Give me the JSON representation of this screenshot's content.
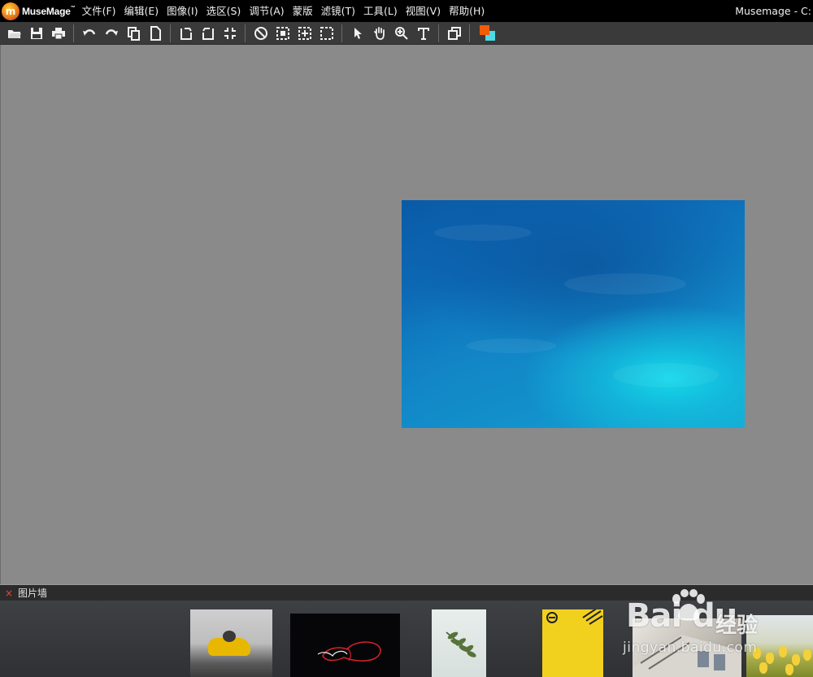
{
  "app": {
    "logo_text": "MuseMage",
    "logo_tm": "™",
    "window_title": "Musemage - C:"
  },
  "menu": [
    {
      "label": "文件(F)",
      "key": "F"
    },
    {
      "label": "编辑(E)",
      "key": "E"
    },
    {
      "label": "图像(I)",
      "key": "I"
    },
    {
      "label": "选区(S)",
      "key": "S"
    },
    {
      "label": "调节(A)",
      "key": "A"
    },
    {
      "label": "蒙版",
      "key": ""
    },
    {
      "label": "滤镜(T)",
      "key": "T"
    },
    {
      "label": "工具(L)",
      "key": "L"
    },
    {
      "label": "视图(V)",
      "key": "V"
    },
    {
      "label": "帮助(H)",
      "key": "H"
    }
  ],
  "toolbar": {
    "groups": [
      [
        "open-icon",
        "save-icon",
        "print-icon"
      ],
      [
        "undo-icon",
        "redo-icon",
        "copy-icon",
        "new-document-icon"
      ],
      [
        "rotate-left-icon",
        "rotate-right-icon",
        "fit-screen-icon"
      ],
      [
        "deselect-icon",
        "select-all-icon",
        "crop-selection-icon",
        "marquee-icon"
      ],
      [
        "pointer-tool-icon",
        "hand-tool-icon",
        "zoom-tool-icon",
        "text-tool-icon"
      ],
      [
        "layers-icon"
      ]
    ],
    "foreground_color": "#f25c05",
    "background_color": "#4fd8e6"
  },
  "panel": {
    "title": "图片墙",
    "close_symbol": "×"
  },
  "watermark": {
    "logo": "Bai du",
    "chinese": "经验",
    "url": "jingyan.baidu.com"
  }
}
